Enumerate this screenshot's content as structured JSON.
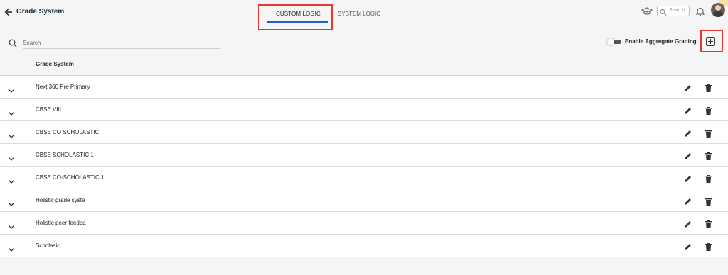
{
  "header": {
    "back_icon": "arrow-left-icon",
    "title": "Grade System",
    "tabs": [
      {
        "label": "CUSTOM LOGIC",
        "active": true
      },
      {
        "label": "SYSTEM LOGIC",
        "active": false
      }
    ],
    "search_placeholder": "Search",
    "accent_color": "#1e5fd6",
    "highlight_color": "#e53935"
  },
  "toolbar": {
    "search_placeholder": "Search",
    "aggregate_toggle_label": "Enable Aggregate Grading",
    "aggregate_enabled": false,
    "add_icon": "plus-square-icon"
  },
  "table": {
    "header": "Grade System",
    "rows": [
      {
        "name": "Next 360 Pre Primary"
      },
      {
        "name": "CBSE VIII"
      },
      {
        "name": "CBSE CO SCHOLASTIC"
      },
      {
        "name": "CBSE SCHOLASTIC 1"
      },
      {
        "name": "CBSE CO-SCHOLASTIC 1"
      },
      {
        "name": "Holistic grade syste"
      },
      {
        "name": "Holistic peer feedba"
      },
      {
        "name": "Scholasic"
      }
    ]
  }
}
